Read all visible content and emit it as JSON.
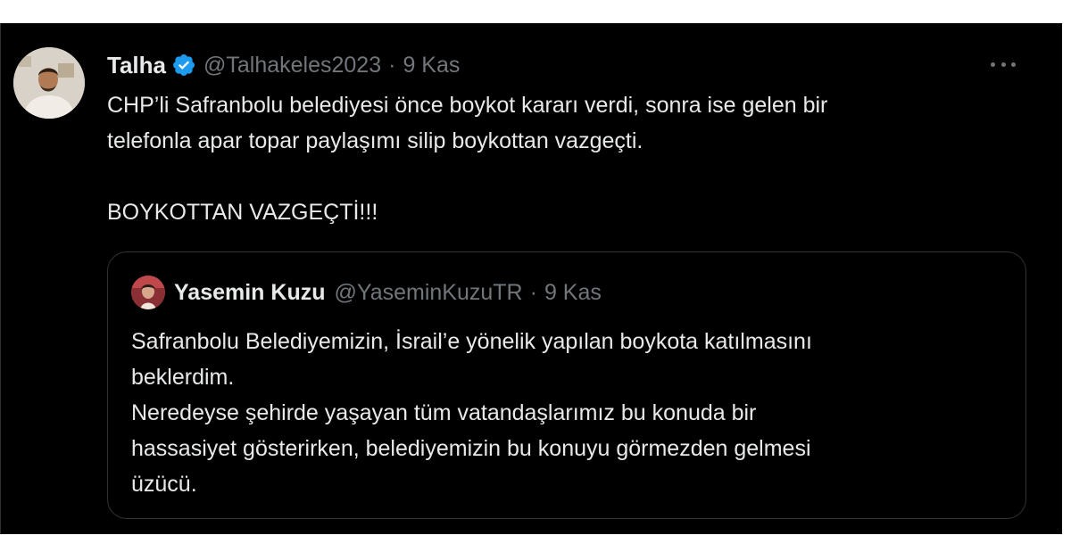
{
  "tweet": {
    "author_name": "Talha",
    "handle": "@Talhakeles2023",
    "separator": "·",
    "date": "9 Kas",
    "verified": true,
    "lines": [
      "CHP’li Safranbolu belediyesi önce boykot kararı verdi, sonra ise gelen bir",
      "telefonla apar topar paylaşımı silip boykottan vazgeçti.",
      "BOYKOTTAN VAZGEÇTİ!!!"
    ]
  },
  "quoted_tweet": {
    "author_name": "Yasemin Kuzu",
    "handle": "@YaseminKuzuTR",
    "separator": "·",
    "date": "9 Kas",
    "lines": [
      "Safranbolu Belediyemizin, İsrail’e yönelik yapılan boykota katılmasını",
      "beklerdim.",
      "Neredeyse şehirde yaşayan tüm vatandaşlarımız bu konuda bir",
      "hassasiyet gösterirken, belediyemizin bu konuyu görmezden gelmesi",
      "üzücü."
    ]
  },
  "icons": {
    "verified": "verified-badge-icon",
    "more": "more-options-icon"
  },
  "colors": {
    "background": "#000000",
    "text_primary": "#e7e9ea",
    "text_secondary": "#71767b",
    "verified_blue": "#1d9bf0",
    "border": "#2f3336"
  }
}
